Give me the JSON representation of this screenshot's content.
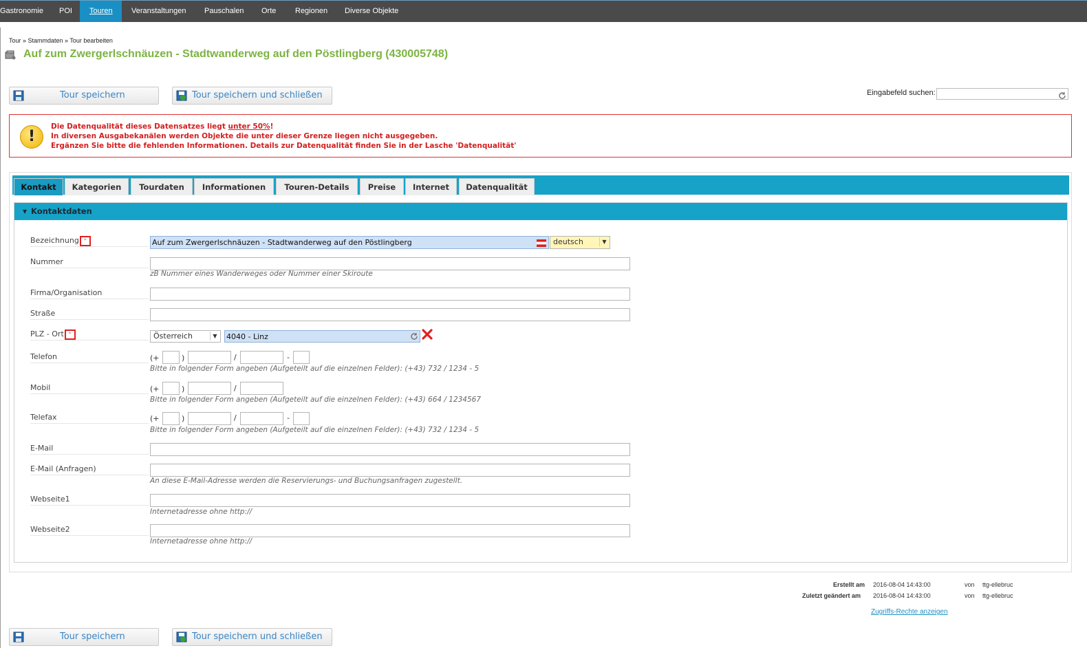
{
  "topnav": {
    "items": [
      "Gastronomie",
      "POI",
      "Touren",
      "Veranstaltungen",
      "Pauschalen",
      "Orte",
      "Regionen",
      "Diverse Objekte"
    ],
    "active": "Touren"
  },
  "breadcrumb": "Tour » Stammdaten » Tour bearbeiten",
  "page_title": "Auf zum Zwergerlschnäuzen - Stadtwanderweg auf den Pöstlingberg (430005748)",
  "buttons": {
    "save": "Tour speichern",
    "save_close": "Tour speichern und schließen"
  },
  "search": {
    "label": "Eingabefeld suchen:",
    "value": ""
  },
  "warning": {
    "line1_pre": "Die Datenqualität dieses Datensatzes liegt ",
    "line1_link": "unter 50%",
    "line1_post": "!",
    "line2": "In diversen Ausgabekanälen werden Objekte die unter dieser Grenze liegen nicht ausgegeben.",
    "line3": "Ergänzen Sie bitte die fehlenden Informationen. Details zur Datenqualität finden Sie in der Lasche 'Datenqualität'"
  },
  "tabs": [
    "Kontakt",
    "Kategorien",
    "Tourdaten",
    "Informationen",
    "Touren-Details",
    "Preise",
    "Internet",
    "Datenqualität"
  ],
  "active_tab": "Kontakt",
  "section_title": "Kontaktdaten",
  "form": {
    "bezeichnung": {
      "label": "Bezeichnung",
      "value": "Auf zum Zwergerlschnäuzen - Stadtwanderweg auf den Pöstlingberg",
      "language": "deutsch"
    },
    "nummer": {
      "label": "Nummer",
      "value": "",
      "hint": "zB Nummer eines Wanderweges oder Nummer einer Skiroute"
    },
    "firma": {
      "label": "Firma/Organisation",
      "value": ""
    },
    "strasse": {
      "label": "Straße",
      "value": ""
    },
    "plz": {
      "label": "PLZ - Ort",
      "country": "Österreich",
      "value": "4040 - Linz"
    },
    "telefon": {
      "label": "Telefon",
      "hint": "Bitte in folgender Form angeben (Aufgeteilt auf die einzelnen Felder): (+43) 732 / 1234 - 5"
    },
    "mobil": {
      "label": "Mobil",
      "hint": "Bitte in folgender Form angeben (Aufgeteilt auf die einzelnen Felder): (+43) 664 / 1234567"
    },
    "telefax": {
      "label": "Telefax",
      "hint": "Bitte in folgender Form angeben (Aufgeteilt auf die einzelnen Felder): (+43) 732 / 1234 - 5"
    },
    "email": {
      "label": "E-Mail",
      "value": ""
    },
    "email_anfragen": {
      "label": "E-Mail (Anfragen)",
      "value": "",
      "hint": "An diese E-Mail-Adresse werden die Reservierungs- und Buchungsanfragen zugestellt."
    },
    "webseite1": {
      "label": "Webseite1",
      "value": "",
      "hint": "Internetadresse ohne http://"
    },
    "webseite2": {
      "label": "Webseite2",
      "value": "",
      "hint": "Internetadresse ohne http://"
    },
    "phone_symbols": {
      "open": "(+",
      "close": ")",
      "slash": "/",
      "dash": "-"
    }
  },
  "meta": {
    "created_label": "Erstellt am",
    "created_date": "2016-08-04 14:43:00",
    "modified_label": "Zuletzt geändert am",
    "modified_date": "2016-08-04 14:43:00",
    "by_label": "von",
    "created_by": "ttg-ellebruc",
    "modified_by": "ttg-ellebruc",
    "rights_link": "Zugriffs-Rechte anzeigen"
  },
  "colors": {
    "nav_bg": "#4a4a4a",
    "nav_active": "#1a8fc4",
    "accent": "#17a2c8",
    "title_green": "#7cb342",
    "warn_red": "#d42020"
  }
}
